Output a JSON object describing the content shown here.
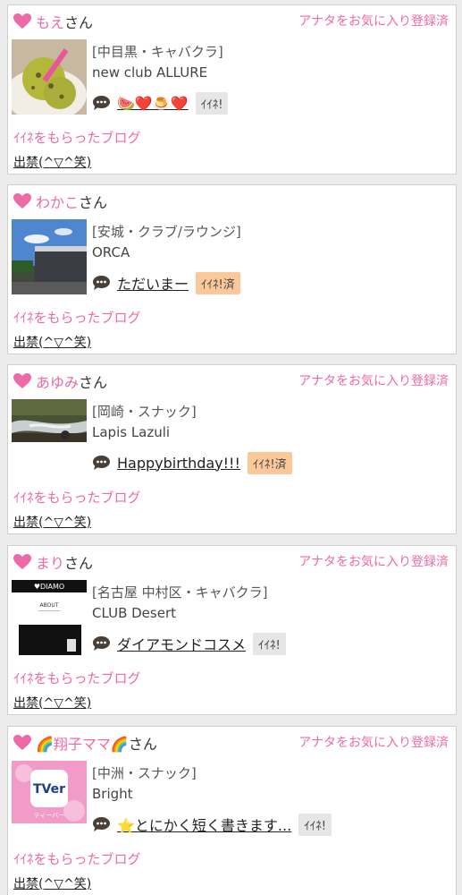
{
  "posts": [
    {
      "user": "もえ",
      "suffix": "さん",
      "fav": "アナタをお気に入り登録済",
      "area": "[中目黒・キャバクラ]",
      "shop": "new club ALLURE",
      "message": "🍉❤️🍮❤️",
      "iine": "ｲｲﾈ!",
      "iine_done": false,
      "blog": "ｲｲﾈをもらったブログ",
      "kin": "出禁(^▽^笑)",
      "thumb": "ice-cream-photo"
    },
    {
      "user": "わかこ",
      "suffix": "さん",
      "fav": "",
      "area": "[安城・クラブ/ラウンジ]",
      "shop": "ORCA",
      "message": "ただいまー",
      "iine": "ｲｲﾈ!済",
      "iine_done": true,
      "blog": "ｲｲﾈをもらったブログ",
      "kin": "出禁(^▽^笑)",
      "thumb": "building-photo"
    },
    {
      "user": "あゆみ",
      "suffix": "さん",
      "fav": "アナタをお気に入り登録済",
      "area": "[岡崎・スナック]",
      "shop": "Lapis Lazuli",
      "message": "Happybirthday!!!",
      "iine": "ｲｲﾈ!済",
      "iine_done": true,
      "blog": "ｲｲﾈをもらったブログ",
      "kin": "出禁(^▽^笑)",
      "thumb": "stream-photo"
    },
    {
      "user": "まり",
      "suffix": "さん",
      "fav": "アナタをお気に入り登録済",
      "area": "[名古屋 中村区・キャバクラ]",
      "shop": "CLUB Desert",
      "message": "ダイアモンドコスメ",
      "iine": "ｲｲﾈ!",
      "iine_done": false,
      "blog": "ｲｲﾈをもらったブログ",
      "kin": "出禁(^▽^笑)",
      "thumb": "diamo-screenshot",
      "thumb_text": [
        "♥DIAMO",
        "ABOUT"
      ]
    },
    {
      "user": "🌈翔子ママ🌈",
      "suffix": "さん",
      "fav": "アナタをお気に入り登録済",
      "area": "[中洲・スナック]",
      "shop": "Bright",
      "message": "⭐とにかく短く書きます...",
      "iine": "ｲｲﾈ!",
      "iine_done": false,
      "blog": "ｲｲﾈをもらったブログ",
      "kin": "出禁(^▽^笑)",
      "thumb": "tver-logo",
      "thumb_text": [
        "TVer",
        "ティーバー"
      ]
    }
  ],
  "colors": {
    "pink": "#ee6aa7",
    "iine_done_bg": "#fbc89a",
    "iine_bg": "#e6e6e6"
  }
}
